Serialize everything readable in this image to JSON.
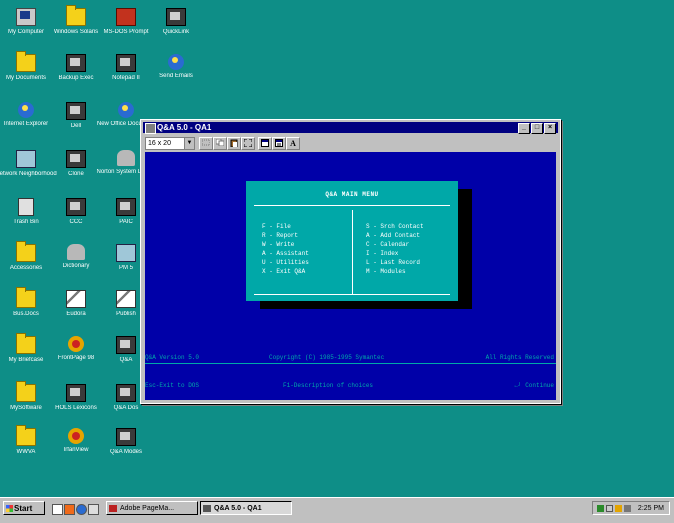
{
  "desktop": {
    "icons": [
      {
        "label": "My Computer",
        "icon": "my-computer-icon"
      },
      {
        "label": "Windows Solaris",
        "icon": "folder-icon"
      },
      {
        "label": "MS-DOS Prompt",
        "icon": "ms-dos-icon"
      },
      {
        "label": "QuickLink",
        "icon": "quicklink-icon"
      },
      {
        "label": "My Documents",
        "icon": "my-documents-icon"
      },
      {
        "label": "Backup Exec",
        "icon": "backup-exec-icon"
      },
      {
        "label": "Notepad II",
        "icon": "notepad-icon"
      },
      {
        "label": "Send Emails",
        "icon": "send-emails-icon"
      },
      {
        "label": "Internet Explorer",
        "icon": "internet-explorer-icon"
      },
      {
        "label": "Dell",
        "icon": "dell-icon"
      },
      {
        "label": "New Office Document",
        "icon": "office-doc-icon"
      },
      {
        "label": "Network Neighborhood",
        "icon": "network-icon"
      },
      {
        "label": "Clone",
        "icon": "clone-icon"
      },
      {
        "label": "Norton System Doctor",
        "icon": "norton-icon"
      },
      {
        "label": "Trash Bin",
        "icon": "recycle-bin-icon"
      },
      {
        "label": "CCC",
        "icon": "ccc-icon"
      },
      {
        "label": "PAIC",
        "icon": "paic-icon"
      },
      {
        "label": "Accessories",
        "icon": "folder-icon"
      },
      {
        "label": "Dictionary",
        "icon": "dictionary-icon"
      },
      {
        "label": "PM 5",
        "icon": "pagemaker-icon"
      },
      {
        "label": "Bus.Docs",
        "icon": "folder-icon"
      },
      {
        "label": "Eudora",
        "icon": "eudora-icon"
      },
      {
        "label": "Publish",
        "icon": "publish-icon"
      },
      {
        "label": "My Briefcase",
        "icon": "folder-icon"
      },
      {
        "label": "FrontPage 98",
        "icon": "frontpage-icon"
      },
      {
        "label": "Q&A",
        "icon": "qa-icon"
      },
      {
        "label": "MySoftware",
        "icon": "folder-icon"
      },
      {
        "label": "HOLS Lexicons",
        "icon": "hols-icon"
      },
      {
        "label": "Q&A Dos",
        "icon": "qa-dos-icon"
      },
      {
        "label": "WWVA",
        "icon": "folder-icon"
      },
      {
        "label": "IrfanView",
        "icon": "irfanview-icon"
      },
      {
        "label": "Q&A Modes",
        "icon": "qa-modes-icon"
      }
    ]
  },
  "window": {
    "title": "Q&A 5.0 - QA1",
    "font_size_value": "16 x 20",
    "toolbar_letter": "A",
    "menu": {
      "title": "Q&A MAIN MENU",
      "left": [
        "F - File",
        "R - Report",
        "W - Write",
        "A - Assistant",
        "U - Utilities",
        "X - Exit Q&A"
      ],
      "right": [
        "S - Srch Contact",
        "A - Add Contact",
        "C - Calendar",
        "I - Index",
        "L - Last Record",
        "M - Modules"
      ]
    },
    "status": {
      "version": "Q&A Version 5.0",
      "copyright": "Copyright (C) 1985-1995  Symantec",
      "rights": "All Rights Reserved",
      "esc": "Esc-Exit to DOS",
      "f1": "F1-Description of choices",
      "enter": "←┘ Continue"
    }
  },
  "taskbar": {
    "start_label": "Start",
    "tasks": [
      {
        "label": "Adobe PageMa...",
        "active": false
      },
      {
        "label": "Q&A 5.0 - QA1",
        "active": true
      }
    ],
    "clock": "2:25 PM"
  },
  "colors": {
    "desktop": "#0e8e87",
    "dos_background": "#0000a8",
    "menu_background": "#00a8a8",
    "title_bar": "#000080"
  }
}
